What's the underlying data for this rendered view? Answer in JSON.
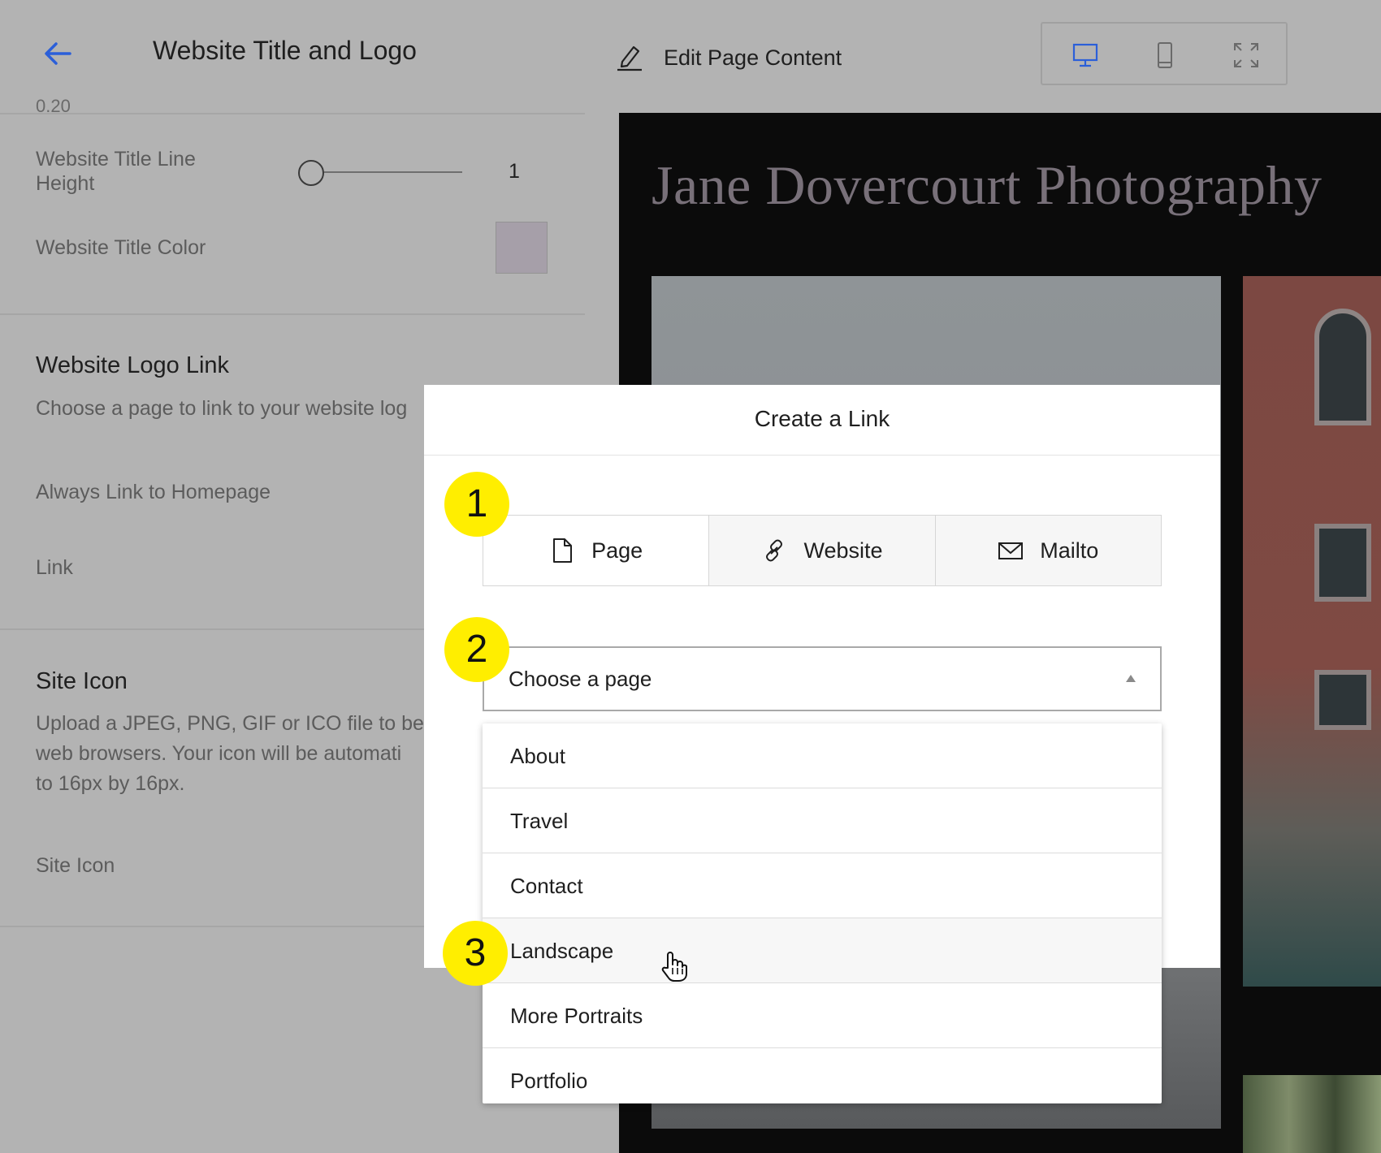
{
  "left_panel": {
    "title": "Website Title and Logo",
    "scrolled_partial": "0.20",
    "title_line_height": {
      "label": "Website Title Line Height",
      "value": "1",
      "slider_fraction": 0.0
    },
    "title_color": {
      "label": "Website Title Color",
      "value": "#a69fa9"
    },
    "logo_link": {
      "title": "Website Logo Link",
      "description": "Choose a page to link to your website log",
      "always_link_label": "Always Link to Homepage",
      "link_label": "Link"
    },
    "site_icon": {
      "title": "Site Icon",
      "description_lines": [
        "Upload a JPEG, PNG, GIF or ICO file to be",
        "web browsers. Your icon will be automati",
        "to 16px by 16px."
      ],
      "label": "Site Icon"
    }
  },
  "toolbar": {
    "edit_label": "Edit Page Content",
    "devices": [
      "desktop-icon",
      "mobile-icon",
      "fullscreen-icon"
    ],
    "active_device": "desktop"
  },
  "preview": {
    "site_title": "Jane Dovercourt Photography"
  },
  "modal": {
    "title": "Create a Link",
    "link_types": [
      {
        "label": "Page",
        "icon": "page-icon"
      },
      {
        "label": "Website",
        "icon": "link-icon"
      },
      {
        "label": "Mailto",
        "icon": "mail-icon"
      }
    ],
    "active_link_type": "Page",
    "page_select": {
      "value": "Choose a page"
    },
    "options": [
      "About",
      "Travel",
      "Contact",
      "Landscape",
      "More Portraits",
      "Portfolio"
    ],
    "hovered_option": "Landscape"
  },
  "badges": [
    "1",
    "2",
    "3"
  ],
  "colors": {
    "accent_blue": "#2b5fd9",
    "badge_yellow": "#ffee00",
    "overlay_gray": "#b3b3b3"
  }
}
